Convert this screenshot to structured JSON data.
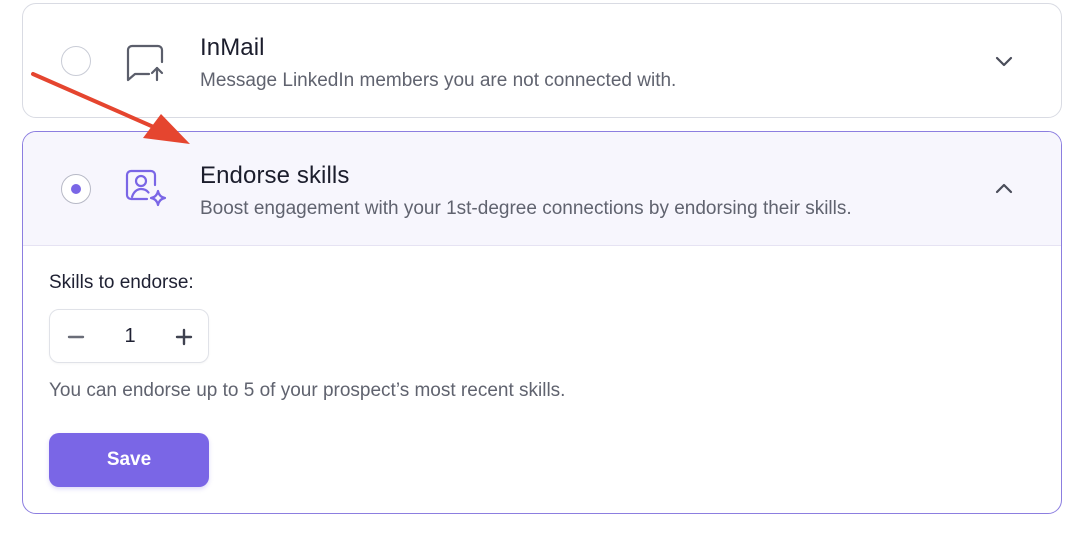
{
  "options": [
    {
      "title": "InMail",
      "description": "Message LinkedIn members you are not connected with.",
      "icon": "message-upload-icon",
      "selected": false,
      "expanded": false
    },
    {
      "title": "Endorse skills",
      "description": "Boost engagement with your 1st-degree connections by endorsing their skills.",
      "icon": "user-sparkle-icon",
      "selected": true,
      "expanded": true
    }
  ],
  "endorse_panel": {
    "skills_label": "Skills to endorse:",
    "stepper_value": "1",
    "help_text": "You can endorse up to 5 of your prospect’s most recent skills.",
    "save_label": "Save"
  },
  "colors": {
    "accent": "#7a66e6",
    "annotation_arrow": "#e5452f"
  }
}
